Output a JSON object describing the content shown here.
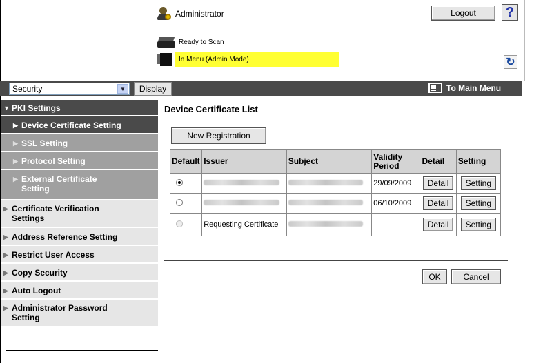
{
  "header": {
    "user_name": "Administrator",
    "logout_label": "Logout",
    "help_label": "?",
    "status_scan": "Ready to Scan",
    "status_menu": "In Menu (Admin Mode)",
    "status_highlight_color": "#ffff33"
  },
  "toolbar": {
    "category_selected": "Security",
    "display_label": "Display",
    "main_menu_label": "To Main Menu"
  },
  "sidebar": {
    "items": [
      {
        "label": "PKI Settings"
      },
      {
        "label": "Device Certificate Setting"
      },
      {
        "label": "SSL Setting"
      },
      {
        "label": "Protocol Setting"
      },
      {
        "label": "External Certificate Setting"
      },
      {
        "label": "Certificate Verification Settings"
      },
      {
        "label": "Address Reference Setting"
      },
      {
        "label": "Restrict User Access"
      },
      {
        "label": "Copy Security"
      },
      {
        "label": "Auto Logout"
      },
      {
        "label": "Administrator Password Setting"
      }
    ]
  },
  "main": {
    "title": "Device Certificate List",
    "new_registration_label": "New Registration",
    "table": {
      "headers": [
        "Default",
        "Issuer",
        "Subject",
        "Validity Period",
        "Detail",
        "Setting"
      ],
      "rows": [
        {
          "validity": "29/09/2009",
          "detail": "Detail",
          "setting": "Setting"
        },
        {
          "validity": "06/10/2009",
          "detail": "Detail",
          "setting": "Setting"
        },
        {
          "issuer": "Requesting Certificate",
          "validity": "",
          "detail": "Detail",
          "setting": "Setting"
        }
      ]
    },
    "ok_label": "OK",
    "cancel_label": "Cancel"
  }
}
